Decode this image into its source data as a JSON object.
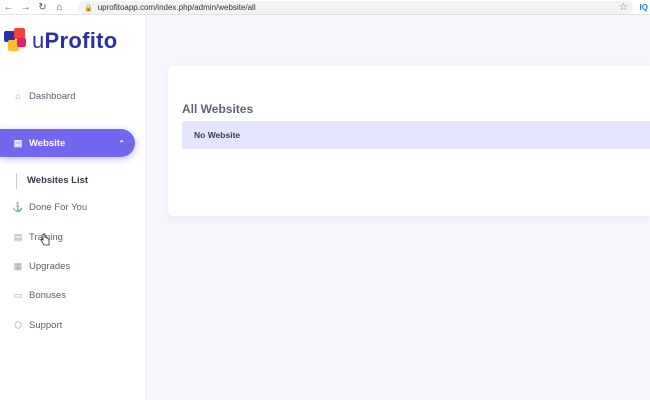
{
  "browser": {
    "back": "←",
    "forward": "→",
    "reload": "↻",
    "home": "⌂",
    "url": "uprofitoapp.com/index.php/admin/website/all",
    "extension_label": "IQ"
  },
  "brand": {
    "logo_u": "u",
    "logo_rest": "Profito",
    "colors": {
      "primary": "#2b2fa8",
      "accent": "#7367f0"
    }
  },
  "sidebar": {
    "items": [
      {
        "label": "Dashboard",
        "icon": "home-icon"
      },
      {
        "label": "Website",
        "icon": "document-icon",
        "active": true
      },
      {
        "label": "Done For You",
        "icon": "anchor-icon"
      },
      {
        "label": "Training",
        "icon": "document-icon"
      },
      {
        "label": "Upgrades",
        "icon": "grid-icon"
      },
      {
        "label": "Bonuses",
        "icon": "bar-chart-icon"
      },
      {
        "label": "Support",
        "icon": "box-icon"
      }
    ],
    "submenu": [
      {
        "label": "Websites List"
      }
    ]
  },
  "main": {
    "title": "All Websites",
    "empty_message": "No Website"
  }
}
